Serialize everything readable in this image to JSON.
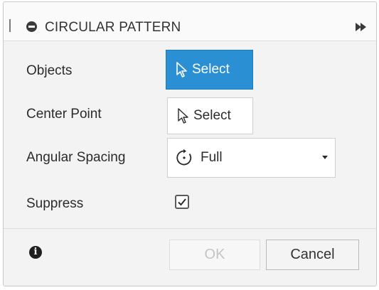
{
  "dialog": {
    "title": "CIRCULAR PATTERN"
  },
  "rows": {
    "objects": {
      "label": "Objects",
      "button_label": "Select",
      "state": "active"
    },
    "center_point": {
      "label": "Center Point",
      "button_label": "Select",
      "state": "normal"
    },
    "angular_spacing": {
      "label": "Angular Spacing",
      "value": "Full"
    },
    "suppress": {
      "label": "Suppress",
      "checked": true
    }
  },
  "footer": {
    "ok_label": "OK",
    "cancel_label": "Cancel"
  },
  "icons": {
    "collapse": "minus-circle-icon",
    "expand": "double-chevron-right-icon",
    "cursor": "cursor-arrow-icon",
    "rotate": "rotate-dotted-icon",
    "info": "info-icon"
  },
  "colors": {
    "accent": "#2a8fd3",
    "panel_bg": "#f3f3f3"
  }
}
